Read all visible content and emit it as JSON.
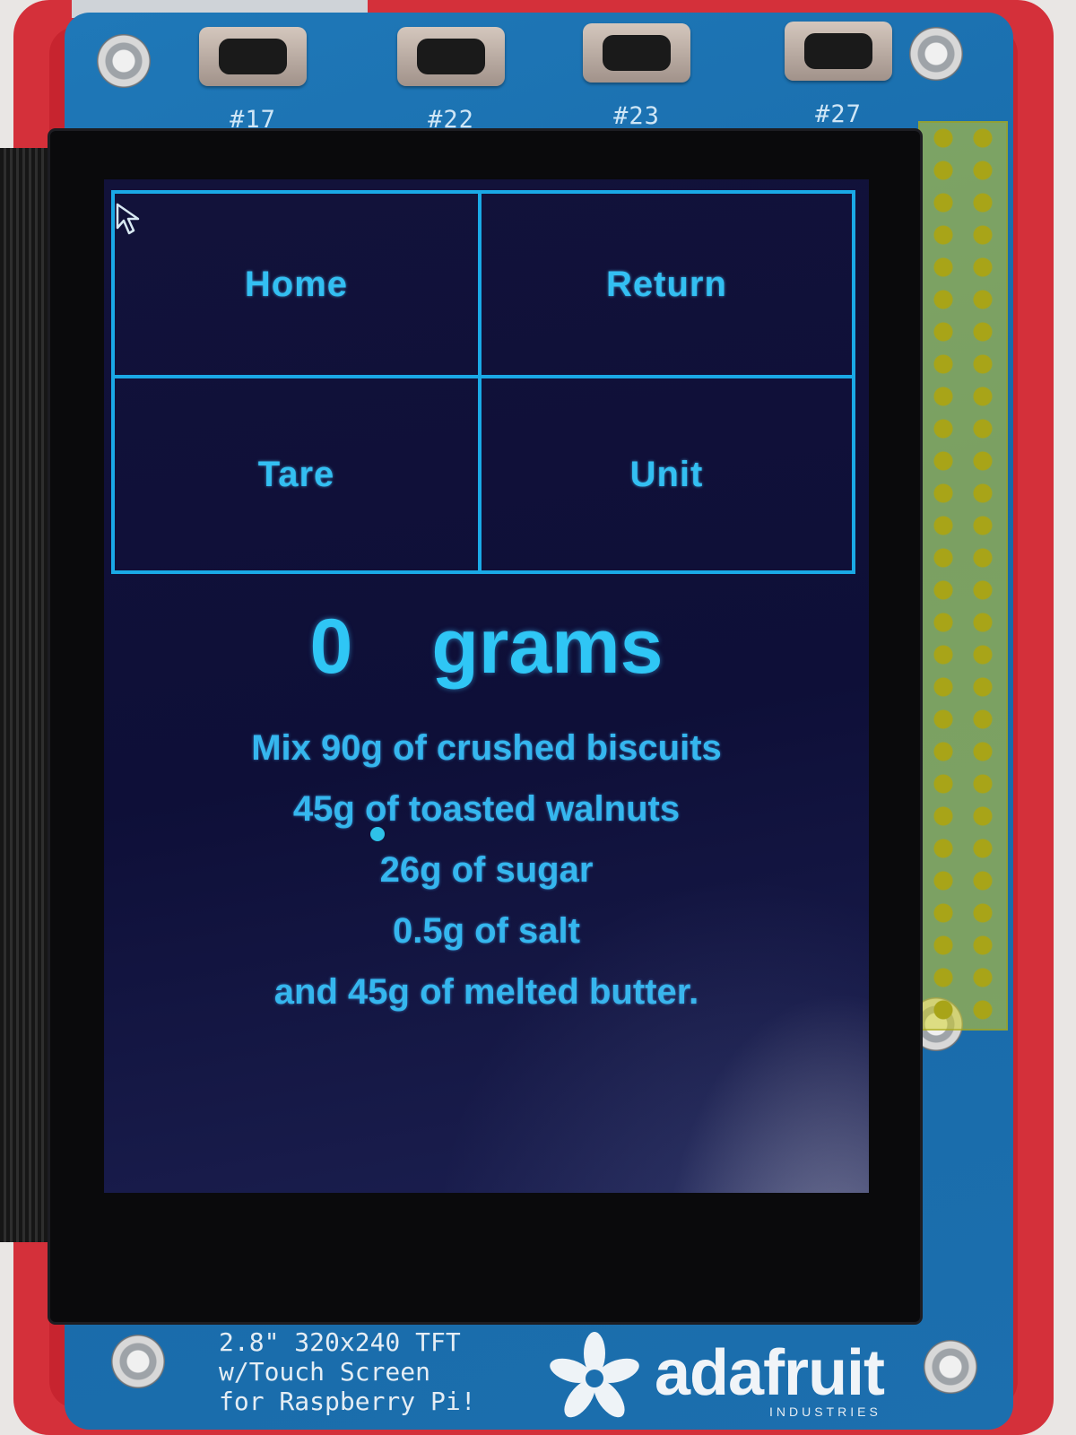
{
  "buttons": {
    "b1": "#17",
    "b2": "#22",
    "b3": "#23",
    "b4": "#27"
  },
  "menu": {
    "home": "Home",
    "return": "Return",
    "tare": "Tare",
    "unit": "Unit"
  },
  "reading": {
    "value": "0",
    "unit": "grams"
  },
  "recipe_lines": [
    "Mix 90g of crushed biscuits",
    "45g of toasted walnuts",
    "26g of sugar",
    "0.5g of salt",
    "and 45g of melted butter."
  ],
  "board": {
    "silkscreen": [
      "2.8\" 320x240 TFT",
      "w/Touch Screen",
      "for Raspberry Pi!"
    ],
    "brand": "adafruit",
    "brand_sub": "INDUSTRIES"
  },
  "colors": {
    "screen_bg": "#10113a",
    "ui_accent": "#1aa9e6",
    "pcb_blue": "#1c6fae"
  }
}
